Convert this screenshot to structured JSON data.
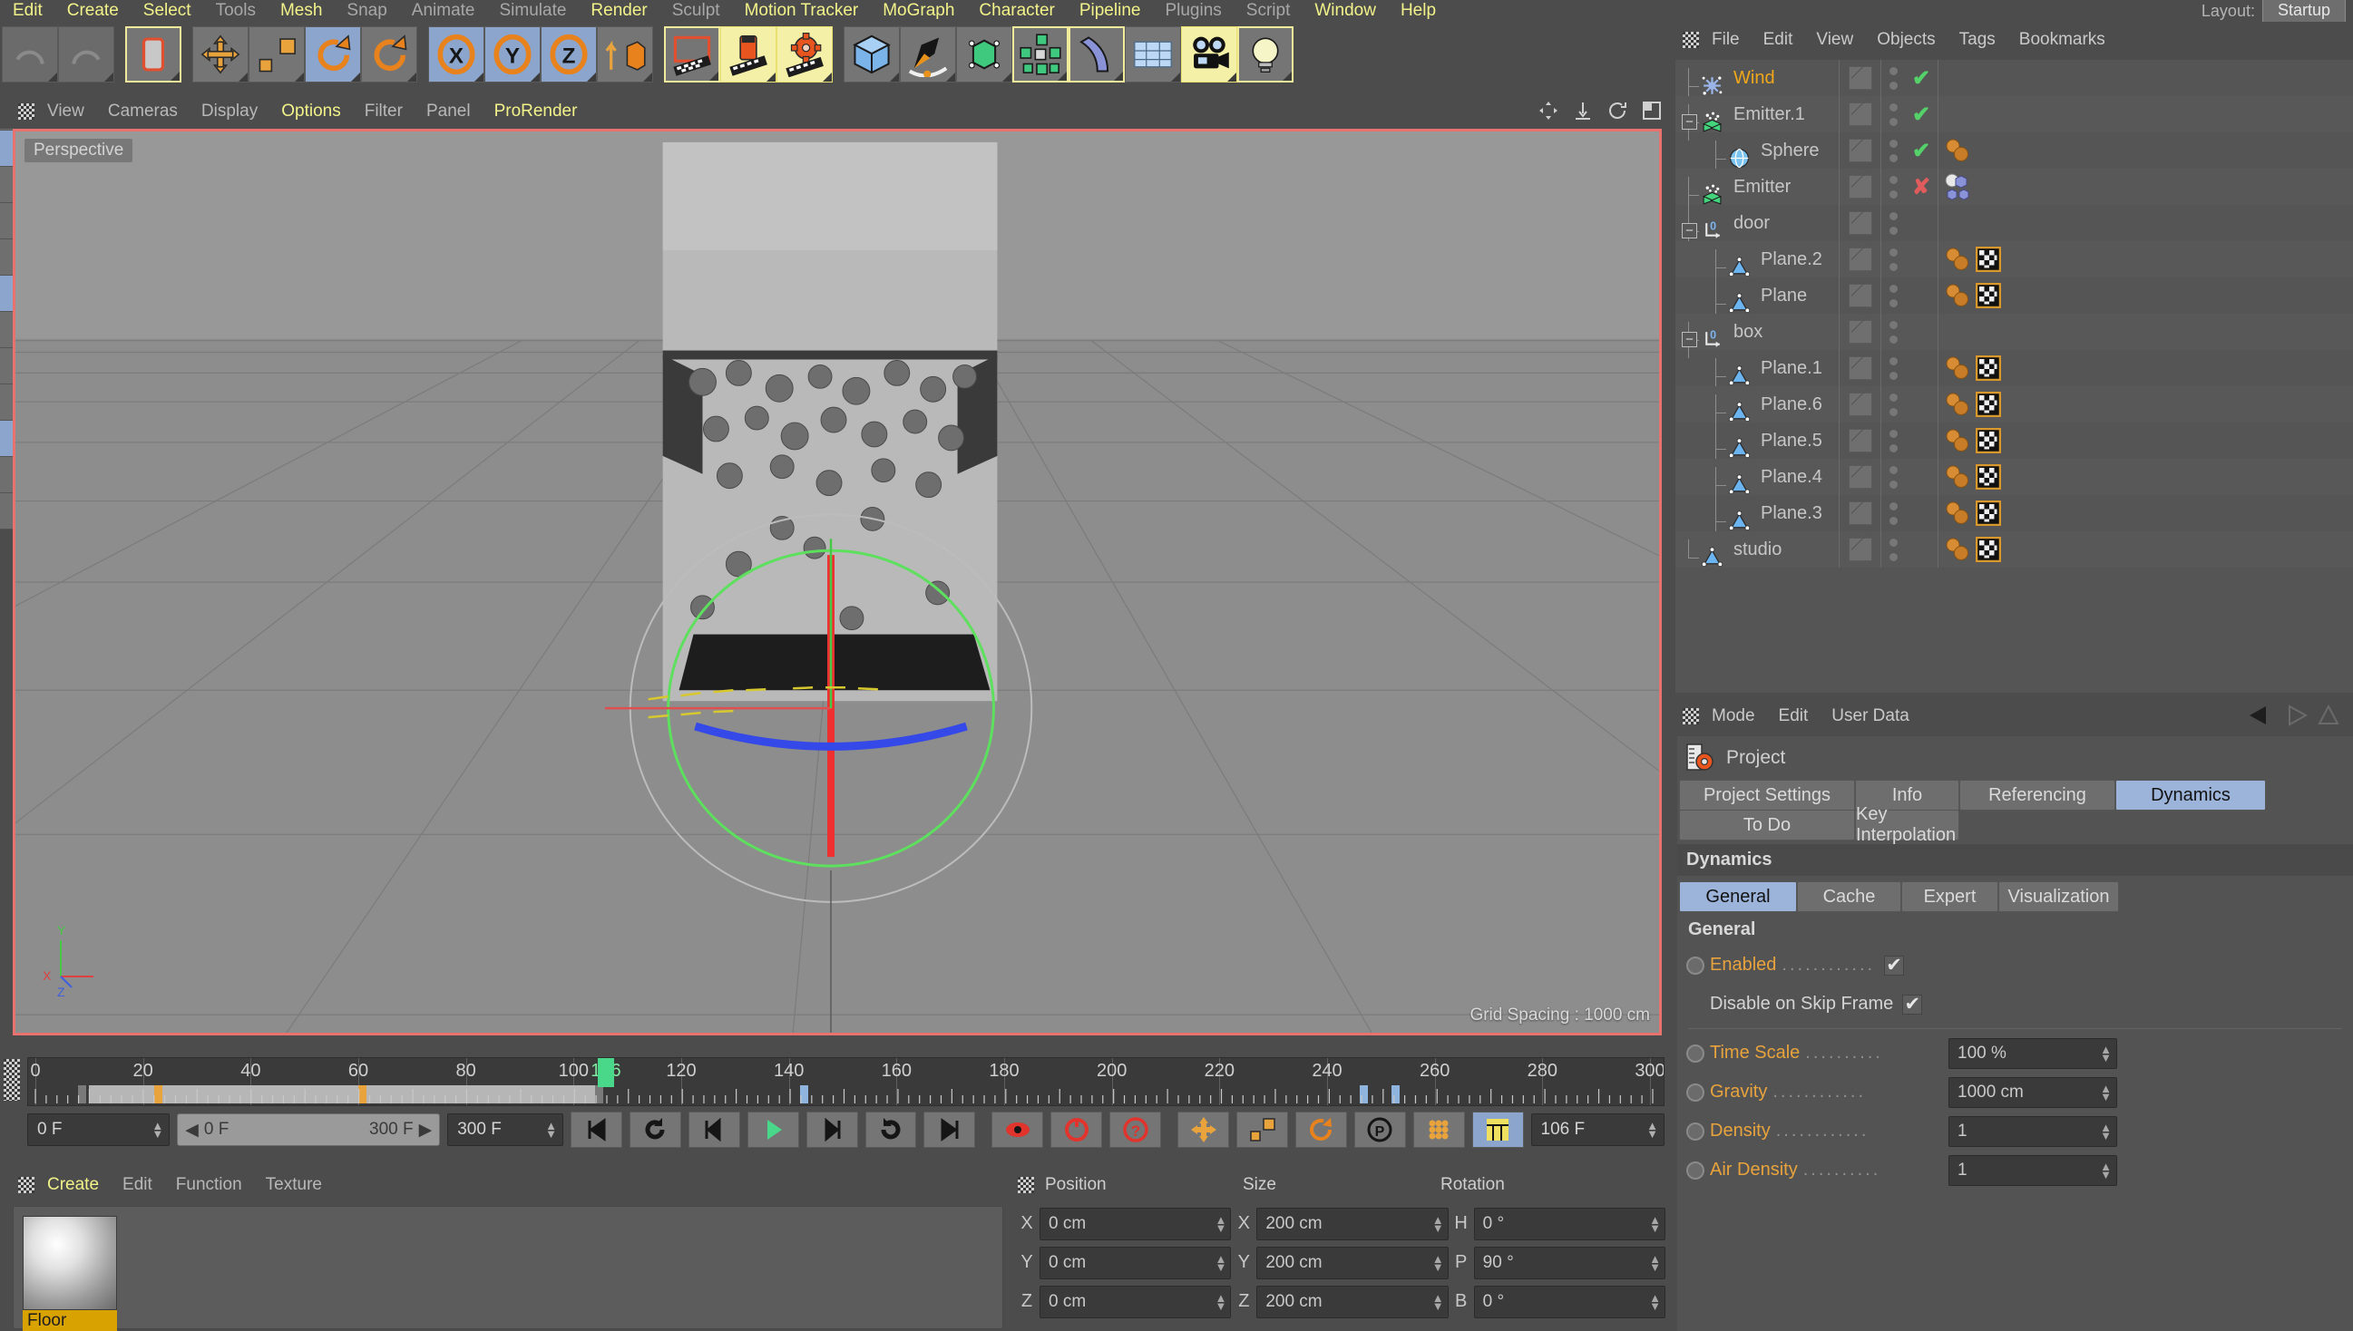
{
  "menubar": {
    "items": [
      {
        "label": "Edit",
        "hl": true
      },
      {
        "label": "Create",
        "hl": true
      },
      {
        "label": "Select",
        "hl": true
      },
      {
        "label": "Tools",
        "hl": false
      },
      {
        "label": "Mesh",
        "hl": true
      },
      {
        "label": "Snap",
        "hl": false
      },
      {
        "label": "Animate",
        "hl": false
      },
      {
        "label": "Simulate",
        "hl": false
      },
      {
        "label": "Render",
        "hl": true
      },
      {
        "label": "Sculpt",
        "hl": false
      },
      {
        "label": "Motion Tracker",
        "hl": true
      },
      {
        "label": "MoGraph",
        "hl": true
      },
      {
        "label": "Character",
        "hl": true
      },
      {
        "label": "Pipeline",
        "hl": true
      },
      {
        "label": "Plugins",
        "hl": false
      },
      {
        "label": "Script",
        "hl": false
      },
      {
        "label": "Window",
        "hl": true
      },
      {
        "label": "Help",
        "hl": true
      }
    ],
    "layout_label": "Layout:",
    "layout_value": "Startup"
  },
  "toolbar": {
    "groups": [
      {
        "buttons": [
          {
            "name": "undo-icon",
            "state": "dim"
          },
          {
            "name": "redo-icon",
            "state": "dim"
          }
        ]
      },
      {
        "buttons": [
          {
            "name": "live-selection-icon",
            "state": "highlight-border"
          }
        ]
      },
      {
        "buttons": [
          {
            "name": "move-tool-icon",
            "state": "normal"
          },
          {
            "name": "scale-tool-icon",
            "state": "normal"
          },
          {
            "name": "rotate-tool-icon",
            "state": "selected"
          },
          {
            "name": "rotate-alt-icon",
            "state": "normal"
          }
        ]
      },
      {
        "buttons": [
          {
            "name": "x-axis-lock-icon",
            "state": "selected"
          },
          {
            "name": "y-axis-lock-icon",
            "state": "selected"
          },
          {
            "name": "z-axis-lock-icon",
            "state": "selected"
          },
          {
            "name": "world-object-axis-icon",
            "state": "normal"
          }
        ]
      },
      {
        "buttons": [
          {
            "name": "render-view-icon",
            "state": "highlight-border"
          },
          {
            "name": "render-region-icon",
            "state": "highlight"
          },
          {
            "name": "render-settings-icon",
            "state": "highlight"
          }
        ]
      },
      {
        "buttons": [
          {
            "name": "cube-primitive-icon",
            "state": "normal"
          },
          {
            "name": "spline-pen-icon",
            "state": "normal"
          },
          {
            "name": "nurbs-generator-icon",
            "state": "normal"
          },
          {
            "name": "array-object-icon",
            "state": "highlight-border"
          },
          {
            "name": "bend-deformer-icon",
            "state": "highlight-border"
          },
          {
            "name": "floor-environment-icon",
            "state": "normal"
          },
          {
            "name": "camera-icon",
            "state": "highlight"
          },
          {
            "name": "light-icon",
            "state": "highlight-border"
          }
        ]
      }
    ]
  },
  "viewport": {
    "menu_items": [
      {
        "label": "View",
        "hl": false
      },
      {
        "label": "Cameras",
        "hl": false
      },
      {
        "label": "Display",
        "hl": false
      },
      {
        "label": "Options",
        "hl": true
      },
      {
        "label": "Filter",
        "hl": false
      },
      {
        "label": "Panel",
        "hl": false
      },
      {
        "label": "ProRender",
        "hl": true
      }
    ],
    "view_label": "Perspective",
    "grid_spacing": "Grid Spacing : 1000 cm",
    "axis_x": "X",
    "axis_y": "Y",
    "axis_z": "Z"
  },
  "timeline": {
    "ticks": [
      {
        "label": "0",
        "pos": 0
      },
      {
        "label": "20",
        "pos": 20
      },
      {
        "label": "40",
        "pos": 40
      },
      {
        "label": "60",
        "pos": 60
      },
      {
        "label": "80",
        "pos": 80
      },
      {
        "label": "100",
        "pos": 100
      },
      {
        "label": "106",
        "pos": 106,
        "current": true
      },
      {
        "label": "120",
        "pos": 120
      },
      {
        "label": "140",
        "pos": 140
      },
      {
        "label": "160",
        "pos": 160
      },
      {
        "label": "180",
        "pos": 180
      },
      {
        "label": "200",
        "pos": 200
      },
      {
        "label": "220",
        "pos": 220
      },
      {
        "label": "240",
        "pos": 240
      },
      {
        "label": "260",
        "pos": 260
      },
      {
        "label": "280",
        "pos": 280
      },
      {
        "label": "300",
        "pos": 300
      }
    ],
    "current_frame": 106,
    "max_frame": 300,
    "current_field": "0 F",
    "range_start": "0 F",
    "range_end": "300 F",
    "end_field": "300 F",
    "frame_display": "106 F",
    "transport": [
      {
        "name": "go-to-start-button",
        "glyph": "start"
      },
      {
        "name": "play-reverse-button",
        "glyph": "loop-left"
      },
      {
        "name": "previous-frame-button",
        "glyph": "prev"
      },
      {
        "name": "play-button",
        "glyph": "play"
      },
      {
        "name": "next-frame-button",
        "glyph": "next"
      },
      {
        "name": "loop-button",
        "glyph": "loop-right"
      },
      {
        "name": "go-to-end-button",
        "glyph": "end"
      },
      {
        "name": "record-active-objects-button",
        "glyph": "record"
      },
      {
        "name": "autokeying-button",
        "glyph": "auto"
      },
      {
        "name": "key-selection-button",
        "glyph": "question"
      },
      {
        "name": "position-key-button",
        "glyph": "move"
      },
      {
        "name": "scale-key-button",
        "glyph": "scale"
      },
      {
        "name": "rotation-key-button",
        "glyph": "rotate"
      },
      {
        "name": "param-key-button",
        "glyph": "param"
      },
      {
        "name": "pla-key-button",
        "glyph": "pla"
      },
      {
        "name": "timeline-toggle-button",
        "glyph": "timeline"
      }
    ]
  },
  "material_manager": {
    "menu_items": [
      {
        "label": "Create",
        "hl": true
      },
      {
        "label": "Edit",
        "hl": false
      },
      {
        "label": "Function",
        "hl": false
      },
      {
        "label": "Texture",
        "hl": false
      }
    ],
    "materials": [
      {
        "name": "Floor"
      }
    ]
  },
  "coordinates": {
    "headers": [
      "Position",
      "Size",
      "Rotation"
    ],
    "rows": [
      {
        "p_axis": "X",
        "p_value": "0 cm",
        "s_axis": "X",
        "s_value": "200 cm",
        "r_axis": "H",
        "r_value": "0 °"
      },
      {
        "p_axis": "Y",
        "p_value": "0 cm",
        "s_axis": "Y",
        "s_value": "200 cm",
        "r_axis": "P",
        "r_value": "90 °"
      },
      {
        "p_axis": "Z",
        "p_value": "0 cm",
        "s_axis": "Z",
        "s_value": "200 cm",
        "r_axis": "B",
        "r_value": "0 °"
      }
    ]
  },
  "object_manager": {
    "menu_items": [
      "File",
      "Edit",
      "View",
      "Objects",
      "Tags",
      "Bookmarks"
    ],
    "objects": [
      {
        "label": "Wind",
        "icon": "wind-icon",
        "depth": 1,
        "expander": "none",
        "selected": true,
        "check": "on",
        "tags": []
      },
      {
        "label": "Emitter.1",
        "icon": "emitter-icon",
        "depth": 1,
        "expander": "minus",
        "selected": false,
        "check": "on",
        "tags": []
      },
      {
        "label": "Sphere",
        "icon": "sphere-icon",
        "depth": 2,
        "expander": "none",
        "selected": false,
        "check": "on",
        "tags": [
          "dynamics"
        ]
      },
      {
        "label": "Emitter",
        "icon": "emitter-icon",
        "depth": 1,
        "expander": "none",
        "selected": false,
        "check": "off",
        "tags": [
          "particle"
        ]
      },
      {
        "label": "door",
        "icon": "null-icon",
        "depth": 1,
        "expander": "minus",
        "selected": false,
        "check": "none",
        "tags": []
      },
      {
        "label": "Plane.2",
        "icon": "plane-icon",
        "depth": 2,
        "expander": "none",
        "selected": false,
        "check": "none",
        "tags": [
          "dynamics",
          "texture"
        ]
      },
      {
        "label": "Plane",
        "icon": "plane-icon",
        "depth": 2,
        "expander": "none",
        "selected": false,
        "check": "none",
        "tags": [
          "dynamics",
          "texture"
        ]
      },
      {
        "label": "box",
        "icon": "null-icon",
        "depth": 1,
        "expander": "minus",
        "selected": false,
        "check": "none",
        "tags": []
      },
      {
        "label": "Plane.1",
        "icon": "plane-icon",
        "depth": 2,
        "expander": "none",
        "selected": false,
        "check": "none",
        "tags": [
          "dynamics",
          "texture"
        ]
      },
      {
        "label": "Plane.6",
        "icon": "plane-icon",
        "depth": 2,
        "expander": "none",
        "selected": false,
        "check": "none",
        "tags": [
          "dynamics",
          "texture"
        ]
      },
      {
        "label": "Plane.5",
        "icon": "plane-icon",
        "depth": 2,
        "expander": "none",
        "selected": false,
        "check": "none",
        "tags": [
          "dynamics",
          "texture"
        ]
      },
      {
        "label": "Plane.4",
        "icon": "plane-icon",
        "depth": 2,
        "expander": "none",
        "selected": false,
        "check": "none",
        "tags": [
          "dynamics",
          "texture"
        ]
      },
      {
        "label": "Plane.3",
        "icon": "plane-icon",
        "depth": 2,
        "expander": "none",
        "selected": false,
        "check": "none",
        "tags": [
          "dynamics",
          "texture"
        ]
      },
      {
        "label": "studio",
        "icon": "plane-icon",
        "depth": 1,
        "expander": "none",
        "selected": false,
        "check": "none",
        "tags": [
          "dynamics",
          "texture"
        ]
      }
    ]
  },
  "attribute_manager": {
    "menu_items": [
      "Mode",
      "Edit",
      "User Data"
    ],
    "object_title": "Project",
    "tabs_row1": [
      {
        "label": "Project Settings",
        "active": false
      },
      {
        "label": "Info",
        "active": false
      },
      {
        "label": "Referencing",
        "active": false
      },
      {
        "label": "Dynamics",
        "active": true
      }
    ],
    "tabs_row2": [
      {
        "label": "To Do",
        "active": false
      },
      {
        "label": "Key Interpolation",
        "active": false
      }
    ],
    "section_title": "Dynamics",
    "subtabs": [
      {
        "label": "General",
        "active": true
      },
      {
        "label": "Cache",
        "active": false
      },
      {
        "label": "Expert",
        "active": false
      },
      {
        "label": "Visualization",
        "active": false
      }
    ],
    "group_title": "General",
    "properties": [
      {
        "name": "enabled",
        "label": "Enabled",
        "kind": "checkbox",
        "value": "✔",
        "checked": true,
        "radio": true,
        "dots": 12
      },
      {
        "name": "disable-on-skip-frame",
        "label": "Disable on Skip Frame",
        "kind": "checkbox",
        "value": "✔",
        "checked": true,
        "radio": false,
        "dots": 0,
        "white": true
      },
      {
        "divider": true
      },
      {
        "name": "time-scale",
        "label": "Time Scale",
        "kind": "field",
        "value": "100 %",
        "radio": true,
        "dots": 10
      },
      {
        "name": "gravity",
        "label": "Gravity",
        "kind": "field",
        "value": "1000 cm",
        "radio": true,
        "dots": 12
      },
      {
        "name": "density",
        "label": "Density",
        "kind": "field",
        "value": "1",
        "radio": true,
        "dots": 12
      },
      {
        "name": "air-density",
        "label": "Air Density",
        "kind": "field",
        "value": "1",
        "radio": true,
        "dots": 10
      }
    ]
  },
  "colors": {
    "accent_yellow": "#f2f28a",
    "accent_orange": "#e8a33c",
    "tab_blue": "#9cb4da",
    "check_green": "#55d16a",
    "check_red": "#e05b5b",
    "viewport_border": "#e8736e",
    "playhead_green": "#49d88a"
  }
}
